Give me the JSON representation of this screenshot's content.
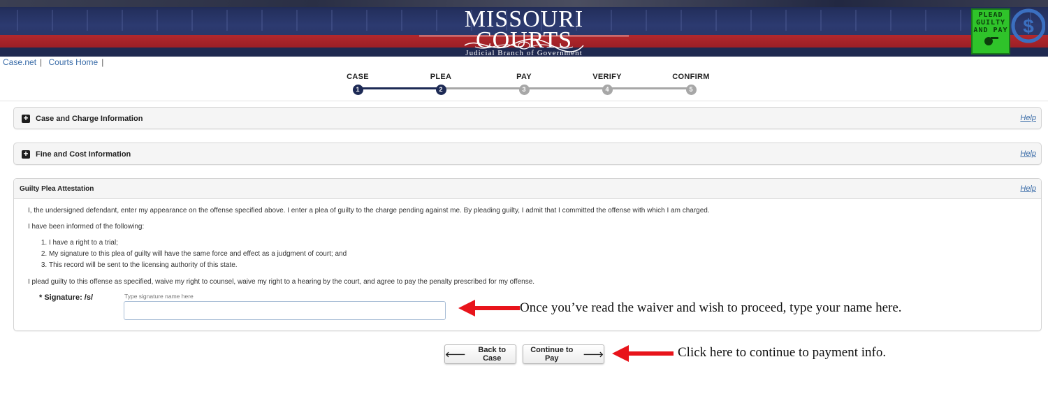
{
  "header": {
    "logo_title": "MISSOURI COURTS",
    "logo_subtitle": "Judicial Branch of Government",
    "badge_lines": [
      "PLEAD",
      "GUILTY",
      "AND PAY"
    ],
    "dollar_symbol": "$"
  },
  "top_links": [
    "Case.net",
    "Courts Home"
  ],
  "steps": [
    {
      "label": "CASE",
      "number": "1",
      "state": "done"
    },
    {
      "label": "PLEA",
      "number": "2",
      "state": "done"
    },
    {
      "label": "PAY",
      "number": "3",
      "state": "todo"
    },
    {
      "label": "VERIFY",
      "number": "4",
      "state": "todo"
    },
    {
      "label": "CONFIRM",
      "number": "5",
      "state": "todo"
    }
  ],
  "panels": {
    "case_charge": {
      "title": "Case and Charge Information",
      "help": "Help",
      "icon": "plus-icon"
    },
    "fine_cost": {
      "title": "Fine and Cost Information",
      "help": "Help",
      "icon": "plus-icon"
    },
    "attestation": {
      "title": "Guilty Plea Attestation",
      "help": "Help",
      "paragraph1": "I, the undersigned defendant, enter my appearance on the offense specified above. I enter a plea of guilty to the charge pending against me. By pleading guilty, I admit that I committed the offense with which I am charged.",
      "paragraph2": "I have been informed of the following:",
      "items": [
        "I have a right to a trial;",
        "My signature to this plea of guilty will have the same force and effect as a judgment of court; and",
        "This record will be sent to the licensing authority of this state."
      ],
      "paragraph3": "I plead guilty to this offense as specified, waive my right to counsel, waive my right to a hearing by the court, and agree to pay the penalty prescribed for my offense.",
      "signature_label": "* Signature: /s/",
      "signature_hint": "Type signature name here",
      "signature_value": ""
    }
  },
  "buttons": {
    "back": "Back to Case",
    "continue": "Continue to Pay"
  },
  "annotations": {
    "signature_note": "Once you’ve read the waiver and wish to proceed, type your name here.",
    "continue_note": "Click here to continue to payment info.",
    "arrow_color": "#e8141b"
  },
  "colors": {
    "link": "#3a6ca8",
    "step_done": "#1d2a55",
    "step_todo": "#a7a7a7",
    "banner_red": "#b2282c",
    "banner_navy": "#24305e",
    "badge_green": "#2fc32a"
  }
}
